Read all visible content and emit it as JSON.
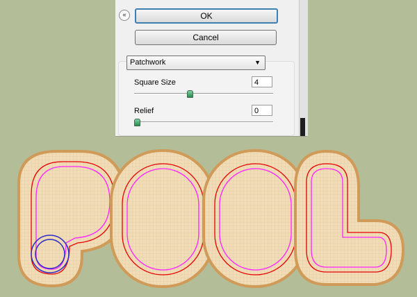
{
  "dialog": {
    "collapse_glyph": "«",
    "ok_label": "OK",
    "cancel_label": "Cancel",
    "filter_select": {
      "value": "Patchwork",
      "arrow": "▼"
    },
    "square_size": {
      "label": "Square Size",
      "value": "4",
      "slider_fraction": 0.4
    },
    "relief": {
      "label": "Relief",
      "value": "0",
      "slider_fraction": 0.0
    }
  },
  "artwork": {
    "letters": [
      "P",
      "O",
      "O",
      "L"
    ],
    "colors": {
      "background": "#b3bd98",
      "outline": "#d09a58",
      "fill": "#f1dcb6",
      "grid": "#d8c59f",
      "red_path": "#e60000",
      "magenta_path": "#ff22ff",
      "blue_circle": "#2c2cc8"
    }
  }
}
